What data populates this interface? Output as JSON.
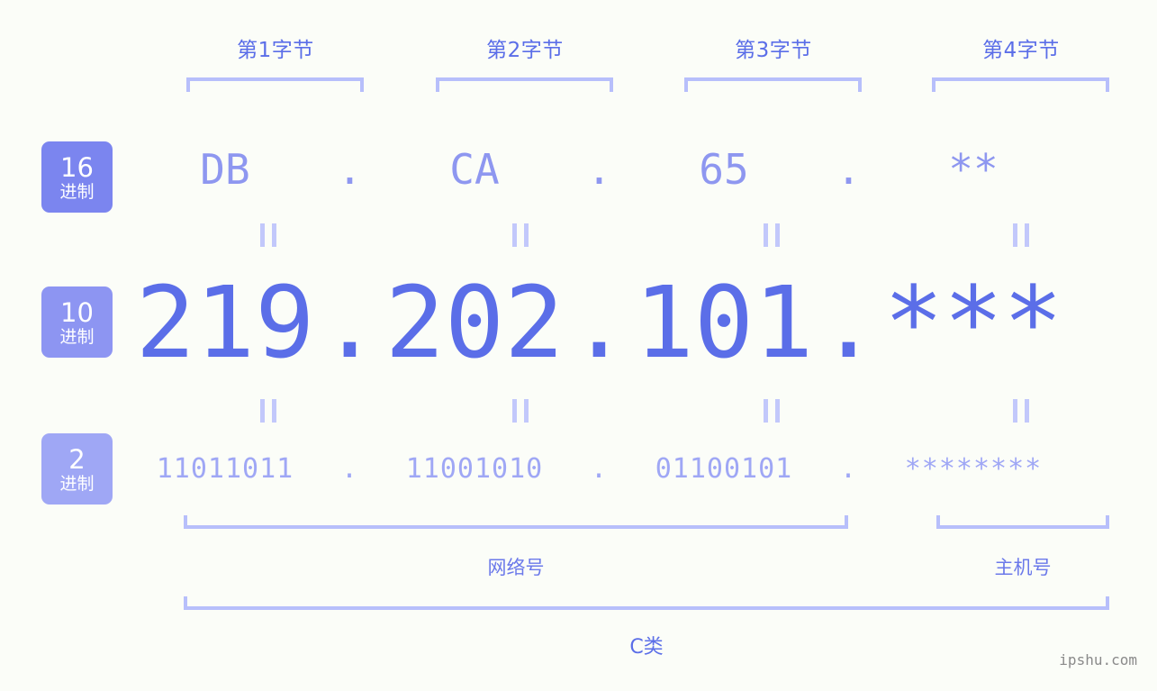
{
  "byte_headers": [
    {
      "label": "第1字节"
    },
    {
      "label": "第2字节"
    },
    {
      "label": "第3字节"
    },
    {
      "label": "第4字节"
    }
  ],
  "bases": [
    {
      "number": "16",
      "unit": "进制",
      "color": "#7b85ef"
    },
    {
      "number": "10",
      "unit": "进制",
      "color": "#8d95f2"
    },
    {
      "number": "2",
      "unit": "进制",
      "color": "#9fa7f5"
    }
  ],
  "rows": {
    "hex": {
      "octets": [
        "DB",
        "CA",
        "65",
        "**"
      ],
      "separators": [
        ".",
        ".",
        "."
      ]
    },
    "decimal": {
      "octets": [
        "219",
        "202",
        "101",
        "***"
      ],
      "separators": [
        ".",
        ".",
        "."
      ]
    },
    "binary": {
      "octets": [
        "11011011",
        "11001010",
        "01100101",
        "********"
      ],
      "separators": [
        ".",
        ".",
        "."
      ]
    }
  },
  "equals_marker": "=",
  "parts": [
    {
      "label": "网络号"
    },
    {
      "label": "主机号"
    }
  ],
  "address_class": {
    "label": "C类"
  },
  "watermark": {
    "text": "ipshu.com"
  },
  "colors": {
    "background": "#fbfdf8",
    "accent_strong": "#5b6ee8",
    "accent_mid": "#8e97f0",
    "accent_light": "#9fa7f5",
    "bracket": "#b7bffb"
  }
}
